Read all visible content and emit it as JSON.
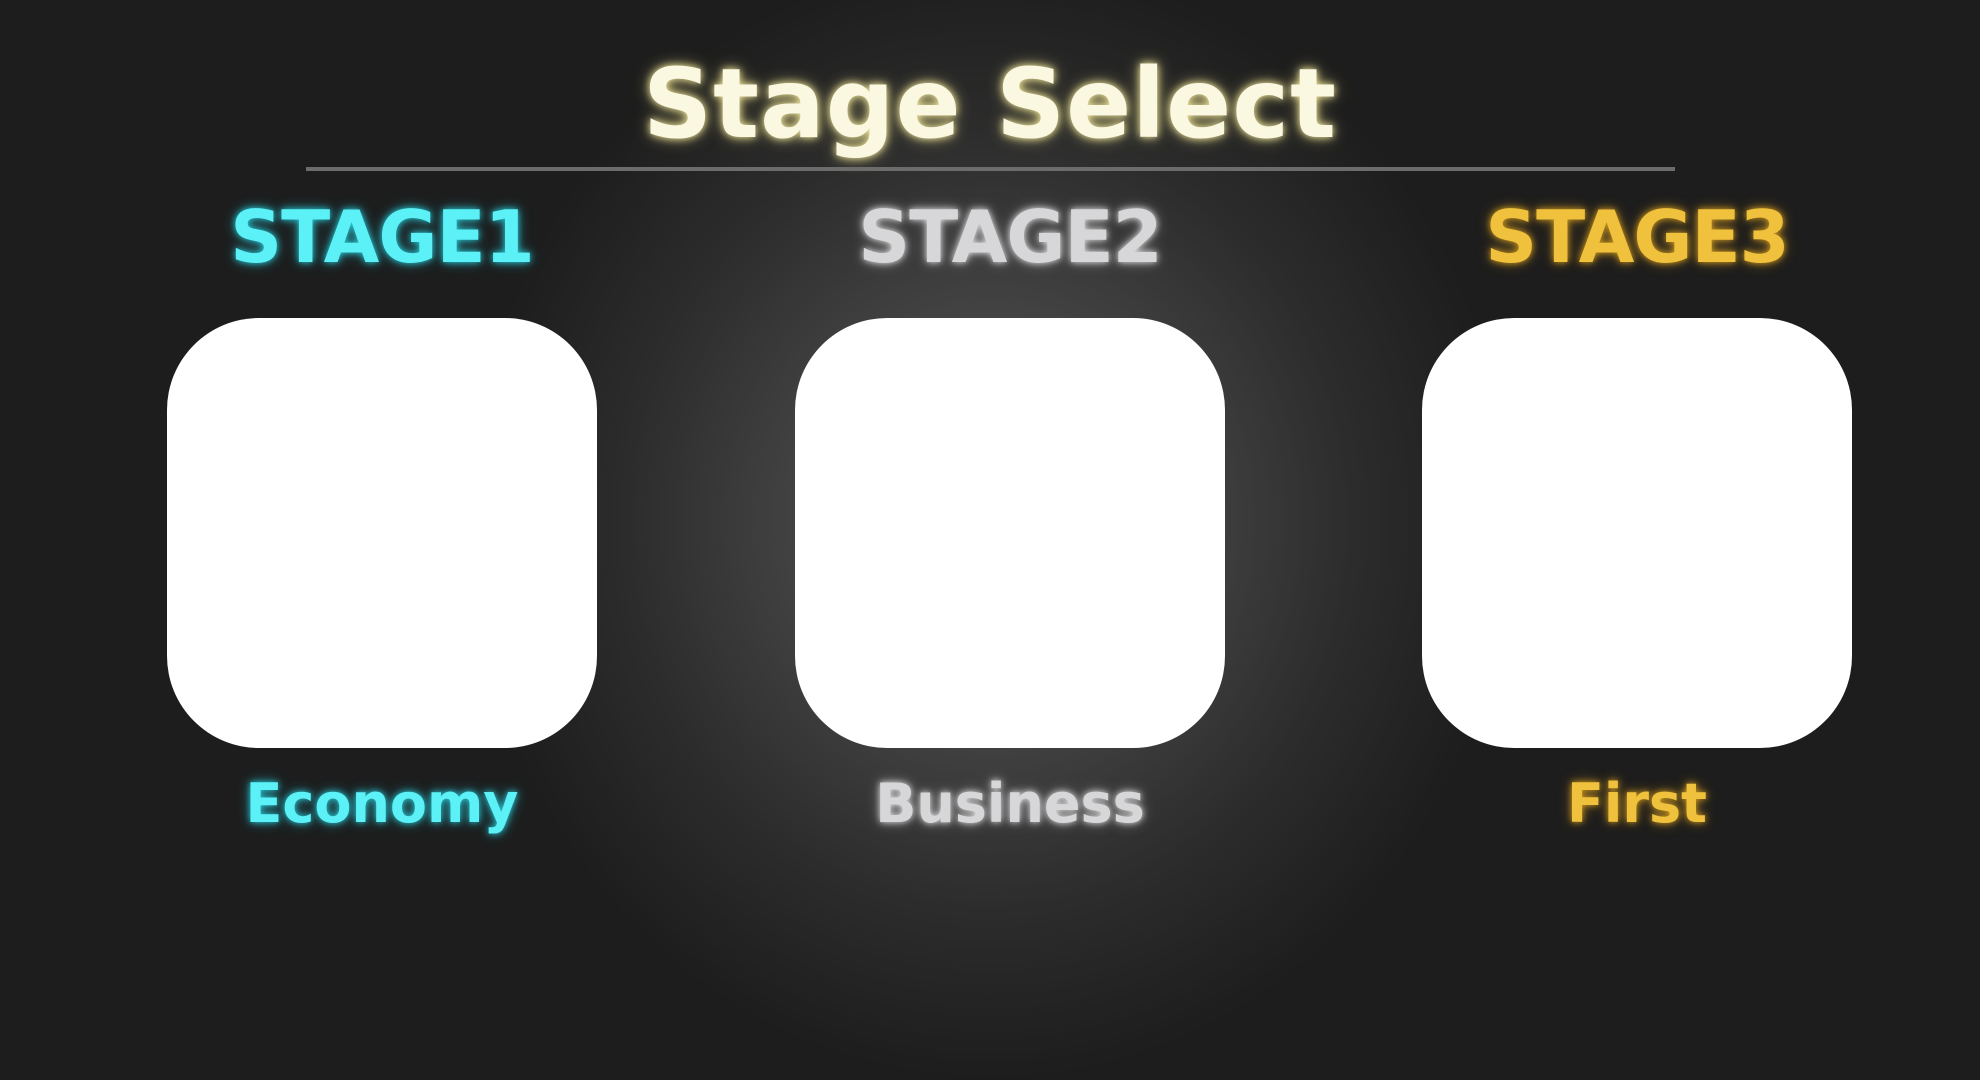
{
  "screen": {
    "title": "Stage Select"
  },
  "stages": [
    {
      "name": "STAGE1",
      "class_label": "Economy",
      "color": "#5cf1f6"
    },
    {
      "name": "STAGE2",
      "class_label": "Business",
      "color": "#d7d7d9"
    },
    {
      "name": "STAGE3",
      "class_label": "First",
      "color": "#f0c13c"
    }
  ],
  "theme": {
    "background": "#1c1c1c",
    "title_color": "#fbf8e2",
    "card_color": "#ffffff",
    "divider_color": "#6c6c6c"
  }
}
